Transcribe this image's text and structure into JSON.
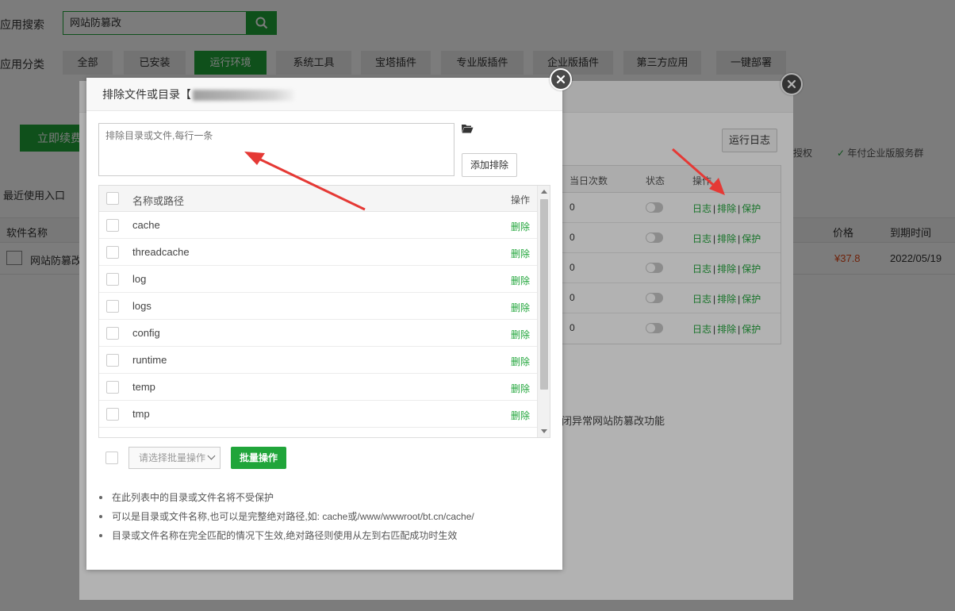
{
  "background": {
    "search_label": "应用搜索",
    "search_value": "网站防篡改",
    "category_label": "应用分类",
    "categories": [
      "全部",
      "已安装",
      "运行环境",
      "系统工具",
      "宝塔插件",
      "专业版插件",
      "企业版插件",
      "第三方应用",
      "一键部署"
    ],
    "active_category": "运行环境",
    "renew_button": "立即续费",
    "recent_label": "最近使用入口",
    "auth_items": [
      "授权",
      "年付企业版服务群"
    ],
    "soft_table": {
      "headers": [
        "软件名称",
        "价格",
        "到期时间"
      ],
      "row": {
        "name": "网站防篡改",
        "price": "¥37.8",
        "expire": "2022/05/19"
      }
    }
  },
  "plugin_window": {
    "run_log_button": "运行日志",
    "table_headers": [
      "当日次数",
      "状态",
      "操作"
    ],
    "rows": [
      {
        "count": "0",
        "ops": [
          "日志",
          "排除",
          "保护"
        ]
      },
      {
        "count": "0",
        "ops": [
          "日志",
          "排除",
          "保护"
        ]
      },
      {
        "count": "0",
        "ops": [
          "日志",
          "排除",
          "保护"
        ]
      },
      {
        "count": "0",
        "ops": [
          "日志",
          "排除",
          "保护"
        ]
      },
      {
        "count": "0",
        "ops": [
          "日志",
          "排除",
          "保护"
        ]
      }
    ],
    "notice": "闭异常网站防篡改功能"
  },
  "dialog": {
    "title": "排除文件或目录【",
    "textarea_placeholder": "排除目录或文件,每行一条",
    "add_button": "添加排除",
    "list_header_name": "名称或路径",
    "list_header_op": "操作",
    "delete_label": "删除",
    "items": [
      "cache",
      "threadcache",
      "log",
      "logs",
      "config",
      "runtime",
      "temp",
      "tmp"
    ],
    "batch_select_placeholder": "请选择批量操作",
    "batch_button": "批量操作",
    "notes": [
      "在此列表中的目录或文件名将不受保护",
      "可以是目录或文件名称,也可以是完整绝对路径,如: cache或/www/wwwroot/bt.cn/cache/",
      "目录或文件名称在完全匹配的情况下生效,绝对路径则使用从左到右匹配成功时生效"
    ]
  },
  "colors": {
    "primary": "#20a53a",
    "price": "#e64a19",
    "arrow": "#e53935"
  },
  "icons": [
    "search-icon",
    "folder-icon",
    "close-icon",
    "check-icon",
    "chevron-down-icon"
  ]
}
